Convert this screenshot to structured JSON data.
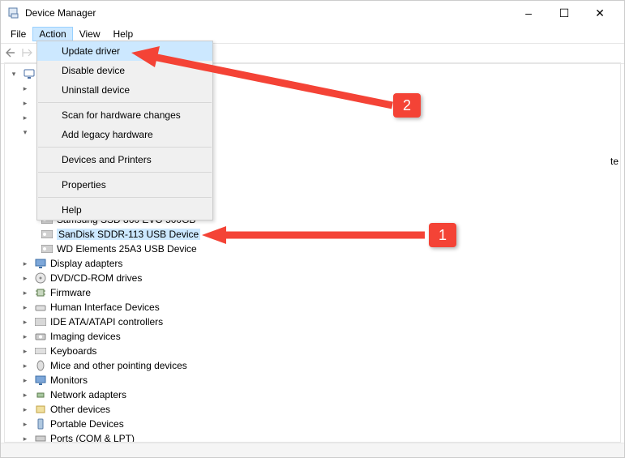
{
  "window": {
    "title": "Device Manager",
    "minimize": "–",
    "maximize": "☐",
    "close": "✕"
  },
  "menubar": {
    "file": "File",
    "action": "Action",
    "view": "View",
    "help": "Help"
  },
  "action_menu": {
    "update_driver": "Update driver",
    "disable_device": "Disable device",
    "uninstall_device": "Uninstall device",
    "scan_hardware": "Scan for hardware changes",
    "add_legacy": "Add legacy hardware",
    "devices_printers": "Devices and Printers",
    "properties": "Properties",
    "help": "Help"
  },
  "tree": {
    "root_hidden_expander": "open",
    "disk_drives_children_hidden_above_count": 2,
    "disk_selected_partial_label_te_suffix": "te",
    "disk_items": {
      "samsung": "Samsung SSD 860 EVO 500GB",
      "sandisk": "SanDisk SDDR-113 USB Device",
      "wd": "WD Elements 25A3 USB Device"
    },
    "categories": {
      "display": "Display adapters",
      "dvd": "DVD/CD-ROM drives",
      "firmware": "Firmware",
      "hid": "Human Interface Devices",
      "ide": "IDE ATA/ATAPI controllers",
      "imaging": "Imaging devices",
      "keyboards": "Keyboards",
      "mice": "Mice and other pointing devices",
      "monitors": "Monitors",
      "network": "Network adapters",
      "other": "Other devices",
      "portable": "Portable Devices",
      "ports": "Ports (COM & LPT)"
    }
  },
  "annotations": {
    "callout1": "1",
    "callout2": "2"
  }
}
